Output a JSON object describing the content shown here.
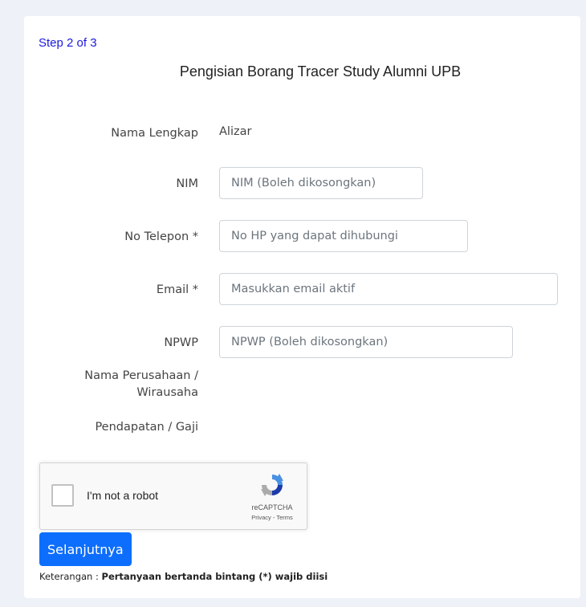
{
  "form": {
    "step": "Step 2 of 3",
    "title": "Pengisian Borang Tracer Study Alumni UPB",
    "fields": {
      "nama": {
        "label": "Nama Lengkap",
        "value": "Alizar"
      },
      "nim": {
        "label": "NIM",
        "placeholder": "NIM (Boleh dikosongkan)"
      },
      "telepon": {
        "label": "No Telepon *",
        "placeholder": "No HP yang dapat dihubungi"
      },
      "email": {
        "label": "Email *",
        "placeholder": "Masukkan email aktif"
      },
      "npwp": {
        "label": "NPWP",
        "placeholder": "NPWP (Boleh dikosongkan)"
      },
      "perusahaan": {
        "label_line1": "Nama Perusahaan /",
        "label_line2": "Wirausaha"
      },
      "pendapatan": {
        "label": "Pendapatan / Gaji"
      }
    }
  },
  "recaptcha": {
    "label": "I'm not a robot",
    "brand": "reCAPTCHA",
    "privacy": "Privacy",
    "separator": " - ",
    "terms": "Terms"
  },
  "submit": {
    "label": "Selanjutnya"
  },
  "note": {
    "prefix": "Keterangan : ",
    "text": "Pertanyaan bertanda bintang (*) wajib diisi"
  },
  "colors": {
    "primary": "#0d6efd",
    "step": "#1a1adf",
    "background": "#eef1f7"
  }
}
